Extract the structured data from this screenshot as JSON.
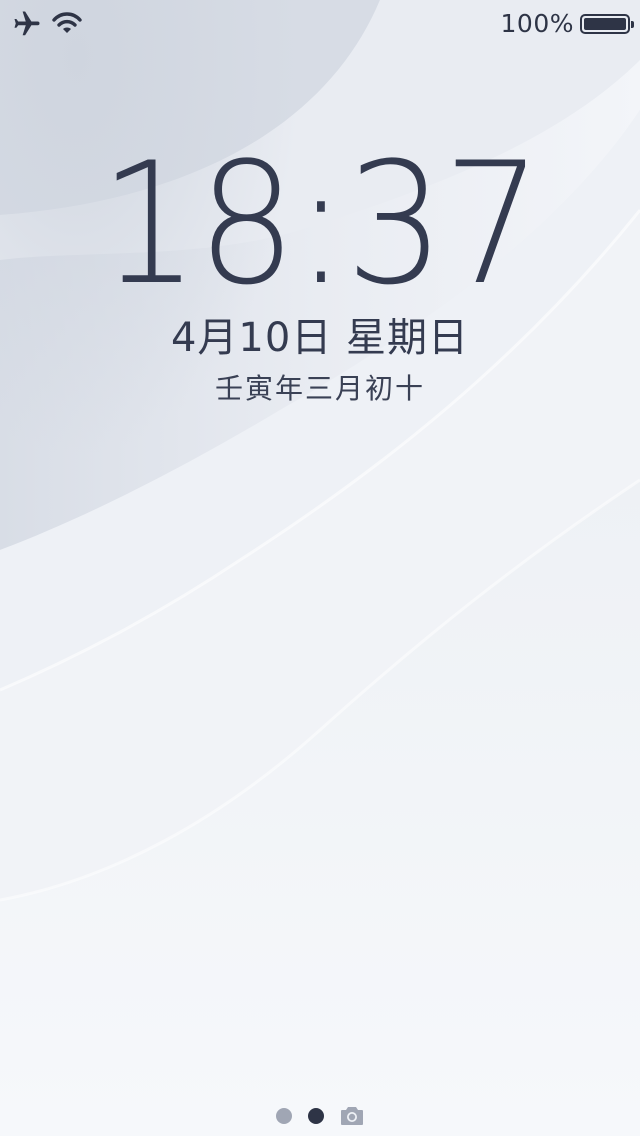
{
  "status_bar": {
    "left_icons": [
      "airplane-icon",
      "wifi-icon"
    ],
    "battery_percent": "100%",
    "battery_level": 1.0
  },
  "lock_screen": {
    "time": "18:37",
    "date": "4月10日 星期日",
    "lunar_date": "壬寅年三月初十"
  },
  "page_indicator": {
    "pages": 3,
    "active_index": 1,
    "items": [
      "dot",
      "dot",
      "camera-icon"
    ]
  },
  "colors": {
    "text_primary": "#343b50",
    "icon_dark": "#2e3446",
    "dot_inactive": "#a0a6b4",
    "wallpaper_base": "#eef1f6"
  }
}
